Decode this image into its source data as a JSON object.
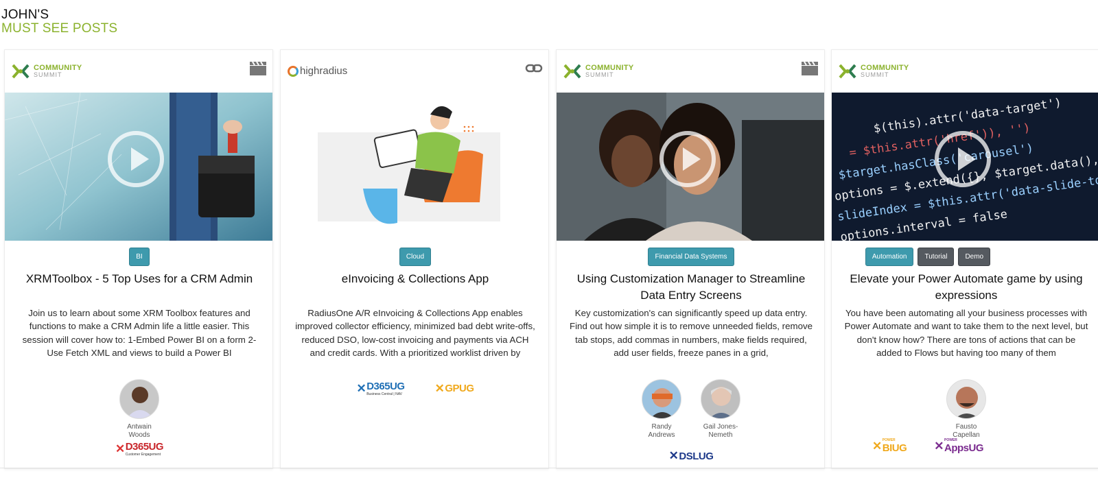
{
  "header": {
    "line1": "JOHN'S",
    "line2": "MUST SEE POSTS"
  },
  "colors": {
    "brand_green": "#8bb22d",
    "tag_blue": "#3e9aad",
    "tag_dark": "#555a60"
  },
  "cards": [
    {
      "logo": {
        "line1": "COMMUNITY",
        "line2": "SUMMIT"
      },
      "type_icon": "video-clapper-icon",
      "tags": [
        "BI"
      ],
      "title": "XRMToolbox - 5 Top Uses for a CRM Admin",
      "description": "Join us to learn about some XRM Toolbox features and functions to make a CRM Admin life a little easier.  This session will cover how to:   1-Embed Power BI on a form 2-Use Fetch XML and views to build a Power BI",
      "speakers": [
        "Antwain Woods"
      ],
      "user_groups": [
        {
          "name": "D365UG",
          "sub": "Customer Engagement"
        }
      ]
    },
    {
      "logo": {
        "text": "highradius"
      },
      "type_icon": "link-icon",
      "tags": [
        "Cloud"
      ],
      "title": "eInvoicing & Collections App",
      "description": "RadiusOne A/R eInvoicing & Collections App enables improved collector efficiency, minimized bad debt write-offs, reduced DSO, low-cost invoicing and payments via ACH and credit cards. With a prioritized worklist driven by",
      "speakers": [],
      "user_groups": [
        {
          "name": "D365UG",
          "sub": "Business Central | NAV"
        },
        {
          "name": "GPUG",
          "sub": ""
        }
      ]
    },
    {
      "logo": {
        "line1": "COMMUNITY",
        "line2": "SUMMIT"
      },
      "type_icon": "video-clapper-icon",
      "tags": [
        "Financial Data Systems"
      ],
      "title": "Using Customization Manager to Streamline Data Entry Screens",
      "description": "Key customization's can significantly speed up data entry.    Find out how simple it is to remove unneeded fields, remove tab stops, add commas in numbers, make fields required, add user fields,  freeze panes in a grid,",
      "speakers": [
        "Randy Andrews",
        "Gail Jones-Nemeth"
      ],
      "user_groups": [
        {
          "name": "DSLUG",
          "sub": ""
        }
      ]
    },
    {
      "logo": {
        "line1": "COMMUNITY",
        "line2": "SUMMIT"
      },
      "type_icon": "",
      "tags": [
        "Automation",
        "Tutorial",
        "Demo"
      ],
      "title": "Elevate your Power Automate game by using expressions",
      "description": "You have been automating all your business processes with Power Automate and want to take them to the next level, but don't know how?  There are tons of actions that can be added to Flows but having too many of them",
      "speakers": [
        "Fausto Capellan"
      ],
      "user_groups": [
        {
          "name": "BIUG",
          "sub": "POWER"
        },
        {
          "name": "AppsUG",
          "sub": "POWER"
        }
      ]
    }
  ]
}
